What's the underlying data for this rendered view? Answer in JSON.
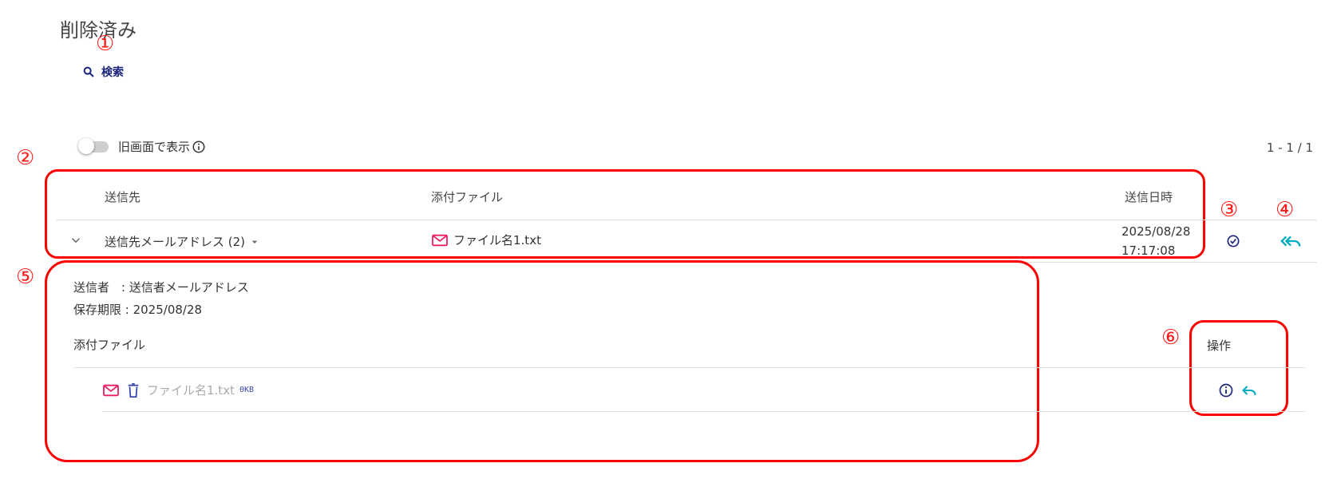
{
  "page": {
    "title": "削除済み"
  },
  "search": {
    "label": "検索"
  },
  "legacy_toggle": {
    "label": "旧画面で表示"
  },
  "pagination": {
    "text": "1 - 1 / 1"
  },
  "table": {
    "headers": {
      "recipient": "送信先",
      "attachment": "添付ファイル",
      "sent_at": "送信日時"
    },
    "row": {
      "recipient": "送信先メールアドレス (2)",
      "attachment": "ファイル名1.txt",
      "sent_date": "2025/08/28",
      "sent_time": "17:17:08"
    }
  },
  "detail": {
    "sender": "送信者　: 送信者メールアドレス",
    "retention": "保存期限 : 2025/08/28",
    "attachments_heading": "添付ファイル",
    "actions_heading": "操作",
    "files": [
      {
        "name": "ファイル名1.txt",
        "size": "0KB"
      }
    ]
  },
  "markers": [
    "①",
    "②",
    "③",
    "④",
    "⑤",
    "⑥"
  ],
  "colors": {
    "accent": "#1a237e",
    "teal": "#00acc1",
    "pink": "#e91e63",
    "annotation": "#ff0000"
  }
}
